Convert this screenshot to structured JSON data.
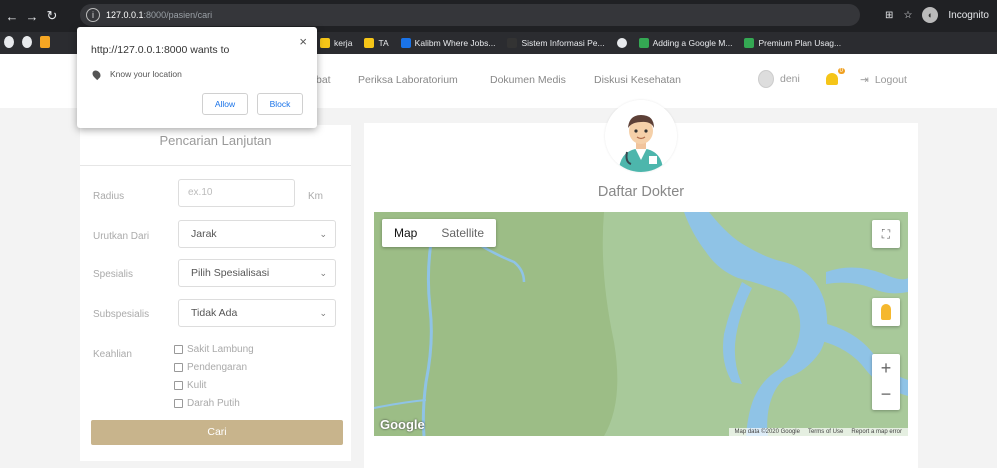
{
  "browser": {
    "url_host": "127.0.0.1",
    "url_rest": ":8000/pasien/cari",
    "incognito_label": "Incognito",
    "bookmarks": [
      {
        "label": "kerja",
        "color": "#f5c518"
      },
      {
        "label": "TA",
        "color": "#f5c518"
      },
      {
        "label": "Kalibm Where Jobs...",
        "color": "#1a73e8"
      },
      {
        "label": "Sistem Informasi Pe...",
        "color": "#333333"
      },
      {
        "label": "",
        "color": "#e8eaed"
      },
      {
        "label": "Adding a Google M...",
        "color": "#34a853"
      },
      {
        "label": "Premium Plan Usag...",
        "color": "#34a853"
      }
    ]
  },
  "permission_popup": {
    "title": "http://127.0.0.1:8000 wants to",
    "request": "Know your location",
    "allow_label": "Allow",
    "block_label": "Block",
    "close_label": "×"
  },
  "navbar": {
    "partial_link": "bat",
    "links": [
      "Periksa Laboratorium",
      "Dokumen Medis",
      "Diskusi Kesehatan"
    ],
    "user_name": "deni",
    "notif_badge": "0",
    "logout_label": "Logout"
  },
  "search": {
    "title": "Pencarian Lanjutan",
    "radius_label": "Radius",
    "radius_placeholder": "ex.10",
    "radius_unit": "Km",
    "sort_label": "Urutkan Dari",
    "sort_value": "Jarak",
    "specialist_label": "Spesialis",
    "specialist_value": "Pilih Spesialisasi",
    "subspecialist_label": "Subspesialis",
    "subspecialist_value": "Tidak Ada",
    "expertise_label": "Keahlian",
    "expertise_options": [
      "Sakit Lambung",
      "Pendengaran",
      "Kulit",
      "Darah Putih"
    ],
    "submit_label": "Cari"
  },
  "doctors": {
    "title": "Daftar Dokter",
    "map": {
      "tab_map": "Map",
      "tab_satellite": "Satellite",
      "google_logo": "Google",
      "footer_data": "Map data ©2020 Google",
      "footer_terms": "Terms of Use",
      "footer_report": "Report a map error",
      "zoom_in": "+",
      "zoom_out": "−",
      "land_color": "#9dbf87",
      "water_color": "#8fc3e6"
    }
  }
}
